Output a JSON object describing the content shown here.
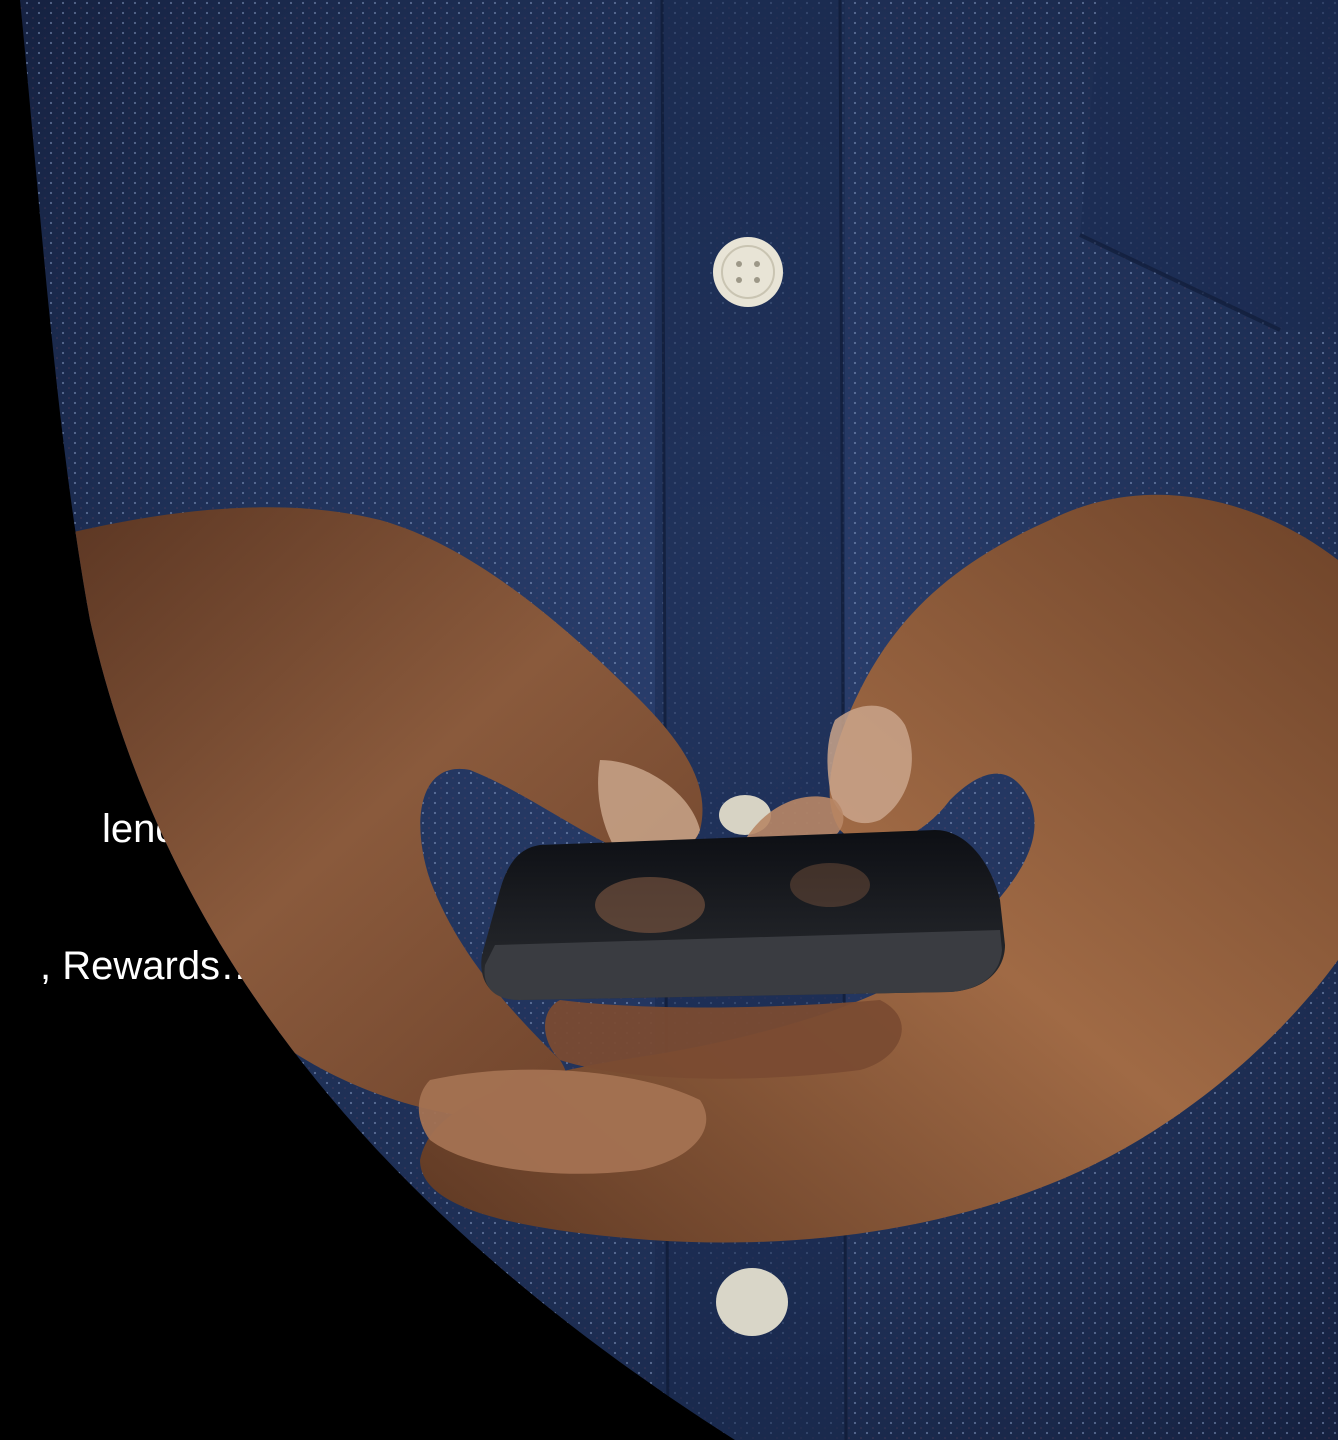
{
  "slide": {
    "text_lines": [
      "lendar",
      ", Rewards…)"
    ]
  },
  "photo": {
    "subject": "hands holding a smartphone in front of a dark blue dotted button-up shirt",
    "shirt_color": "#1e2f55",
    "skin_color": "#8a5a3c",
    "phone_color": "#1a1a1c",
    "background_color": "#000000"
  }
}
